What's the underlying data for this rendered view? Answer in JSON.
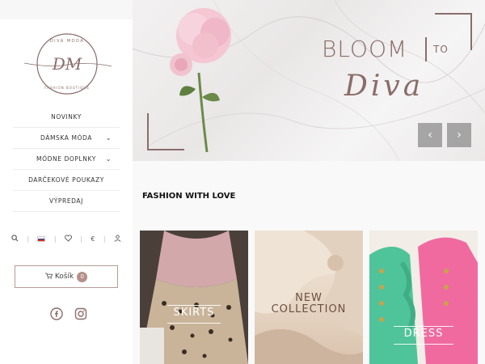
{
  "brand": {
    "logo_monogram": "DM",
    "logo_top_text": "DIVA MODA",
    "logo_bottom_text": "FASHION BOUTIQUE"
  },
  "sidebar": {
    "nav": [
      {
        "label": "NOVINKY",
        "has_dropdown": false
      },
      {
        "label": "DÁMSKA MÓDA",
        "has_dropdown": true
      },
      {
        "label": "MÓDNE DOPLNKY",
        "has_dropdown": true
      },
      {
        "label": "DARČEKOVÉ POUKAZY",
        "has_dropdown": false
      },
      {
        "label": "VÝPREDAJ",
        "has_dropdown": false
      }
    ],
    "utility": {
      "search_icon": "search-icon",
      "flag": "sk-flag",
      "wishlist_icon": "heart-icon",
      "currency": "€",
      "account_icon": "user-icon"
    },
    "cart": {
      "label": "Košík",
      "count": "0",
      "icon": "cart-icon"
    },
    "social": [
      "facebook-icon",
      "instagram-icon"
    ]
  },
  "hero": {
    "title": "BLOOM",
    "title_suffix": "TO",
    "script": "Diva",
    "prev_arrow": "‹",
    "next_arrow": "›"
  },
  "main": {
    "section_title": "FASHION WITH LOVE",
    "cards": [
      {
        "label": "SKIRTS"
      },
      {
        "label_line1": "NEW",
        "label_line2": "COLLECTION"
      },
      {
        "label": "DRESS"
      }
    ]
  },
  "colors": {
    "accent": "#8a6d6a",
    "cart_badge": "#b58f8a"
  }
}
